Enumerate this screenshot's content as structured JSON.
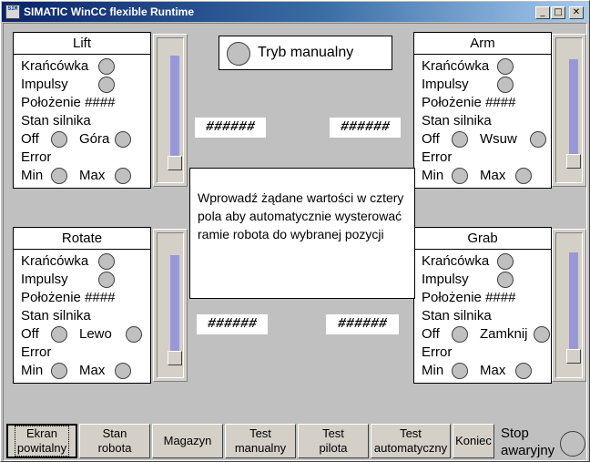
{
  "window": {
    "title": "SIMATIC WinCC flexible Runtime",
    "icon_text": "SIM",
    "minimize": "_",
    "maximize": "□",
    "close": "✕"
  },
  "labels": {
    "limit": "Krańcówka",
    "pulses": "Impulsy",
    "position": "Położenie",
    "position_value": "####",
    "motor_state": "Stan silnika",
    "off": "Off",
    "error": "Error",
    "min": "Min",
    "max": "Max"
  },
  "panels": {
    "lift": {
      "title": "Lift",
      "direction": "Góra"
    },
    "arm": {
      "title": "Arm",
      "direction": "Wsuw"
    },
    "rotate": {
      "title": "Rotate",
      "direction": "Lewo"
    },
    "grab": {
      "title": "Grab",
      "direction": "Zamknij"
    }
  },
  "mode": {
    "label": "Tryb manualny"
  },
  "inputs": {
    "top_left": "######",
    "top_right": "######",
    "bottom_left": "######",
    "bottom_right": "######"
  },
  "info_text": "Wprowadź żądane wartości w cztery pola aby automatycznie wysterować ramie robota do wybranej pozycji",
  "nav": {
    "welcome": "Ekran\npowitalny",
    "robot_state": "Stan\nrobota",
    "warehouse": "Magazyn",
    "test_manual": "Test\nmanualny",
    "test_pilot": "Test\npilota",
    "test_auto": "Test\nautomatyczny",
    "end": "Koniec"
  },
  "emergency_stop": {
    "label": "Stop\nawaryjny"
  },
  "colors": {
    "background": "#c0c0c0",
    "slider_track": "#9898d8",
    "titlebar": "#0a246a"
  }
}
